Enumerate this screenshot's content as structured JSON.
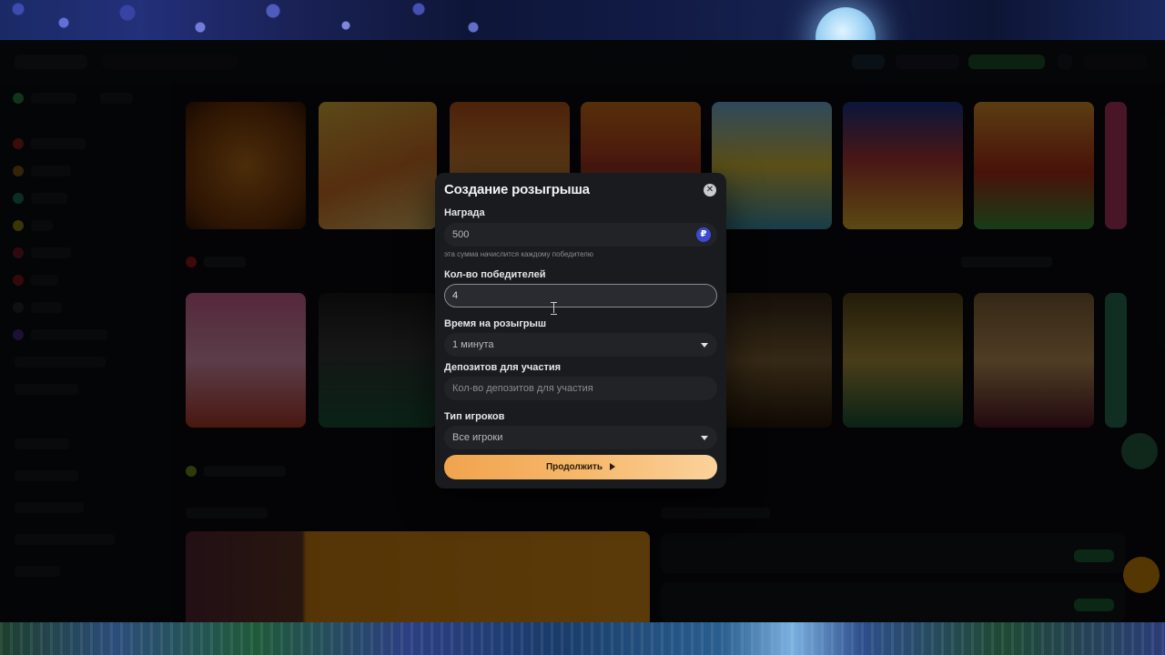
{
  "modal": {
    "title": "Создание розыгрыша",
    "close_icon": "close-icon",
    "prize": {
      "label": "Награда",
      "value": "500",
      "currency_icon": "ruble-icon",
      "currency_symbol": "₽",
      "hint": "эта сумма начислится каждому победителю"
    },
    "winners": {
      "label": "Кол-во победителей",
      "value": "4"
    },
    "duration": {
      "label": "Время на розыгрыш",
      "selected": "1 минута"
    },
    "deposits": {
      "label": "Депозитов для участия",
      "placeholder": "Кол-во депозитов для участия"
    },
    "player_type": {
      "label": "Тип игроков",
      "selected": "Все игроки"
    },
    "submit_label": "Продолжить",
    "submit_icon": "play-arrow-icon"
  },
  "colors": {
    "modal_bg": "#1a1b1f",
    "accent_start": "#f0a44d",
    "accent_end": "#fbd29c",
    "ruble_badge": "#3a4bd1"
  }
}
